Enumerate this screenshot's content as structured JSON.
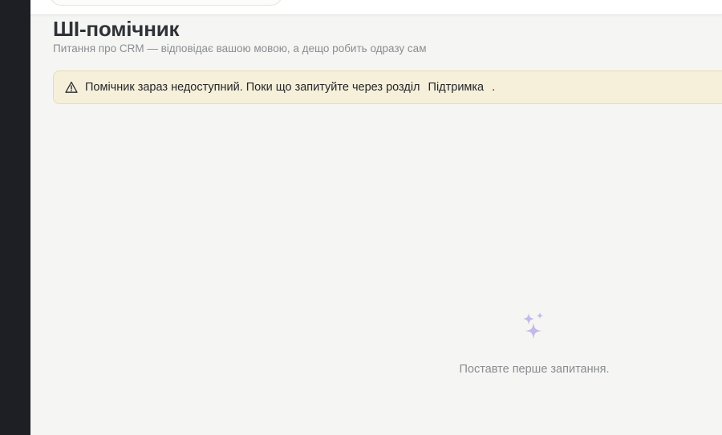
{
  "page": {
    "title": "ШІ-помічник",
    "subtitle": "Питання про CRM — відповідає вашою мовою, а дещо робить одразу сам"
  },
  "notice": {
    "icon": "warning-triangle-icon",
    "text": "Помічник зараз недоступний. Поки що запитуйте через розділ",
    "link_label": "Підтримка",
    "suffix": "."
  },
  "empty_state": {
    "icon": "sparkle-icon",
    "text": "Поставте перше запитання."
  },
  "colors": {
    "sidebar": "#1d1f25",
    "notice_bg": "#f6efd9",
    "notice_border": "#ebdcaf",
    "sparkle": "#c4b8ec"
  }
}
